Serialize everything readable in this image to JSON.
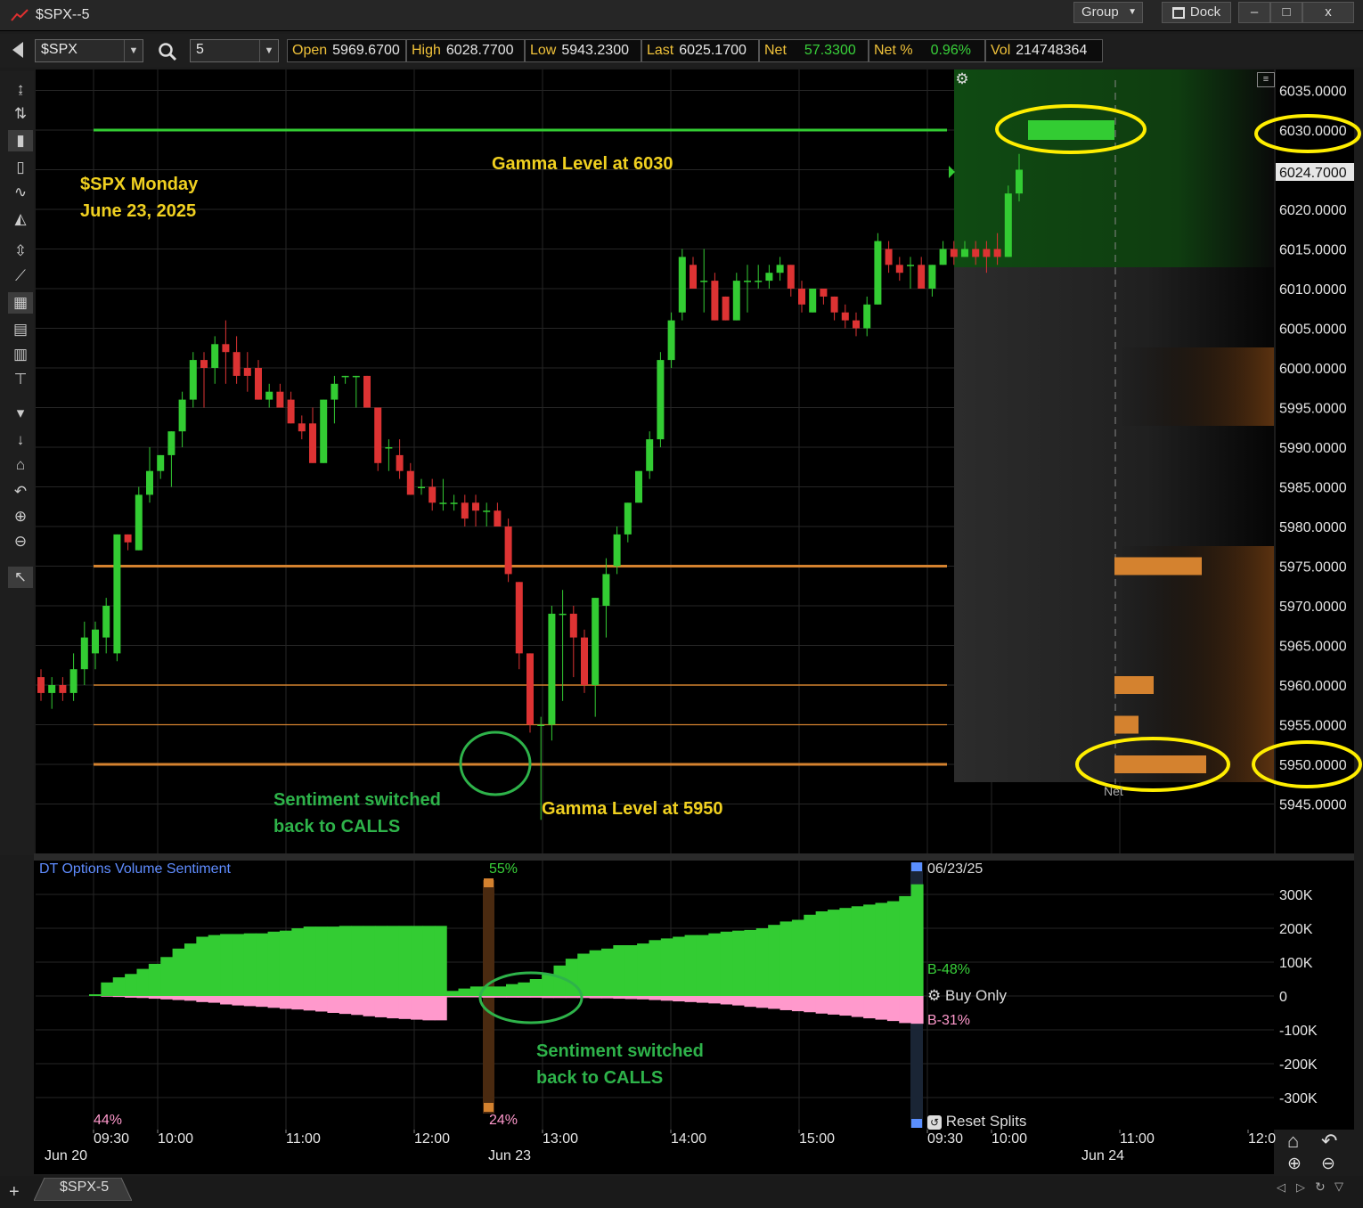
{
  "window": {
    "title": "$SPX--5",
    "group_label": "Group",
    "dock_label": "Dock",
    "min_label": "–",
    "max_label": "□",
    "close_label": "x"
  },
  "toolbar": {
    "symbol": "$SPX",
    "interval": "5",
    "quotes": [
      {
        "label": "Open",
        "value": "5969.6700",
        "tone": "white"
      },
      {
        "label": "High",
        "value": "6028.7700",
        "tone": "white"
      },
      {
        "label": "Low",
        "value": "5943.2300",
        "tone": "white"
      },
      {
        "label": "Last",
        "value": "6025.1700",
        "tone": "white"
      },
      {
        "label": "Net",
        "value": "57.3300",
        "tone": "green"
      },
      {
        "label": "Net %",
        "value": "0.96%",
        "tone": "green"
      },
      {
        "label": "Vol",
        "value": "214748364",
        "tone": "white"
      }
    ]
  },
  "left_tools": [
    "arrows-vertical-icon",
    "cursor-split-icon",
    "candles-icon",
    "bars-icon",
    "line-icon",
    "mountain-icon",
    "scale-icon",
    "trendline-icon",
    "grid-icon",
    "table-icon",
    "table-small-icon",
    "crosshair-icon",
    "draw-down-icon",
    "small-arrow-icon",
    "home-icon",
    "undo-icon",
    "zoom-in-icon",
    "zoom-out-icon",
    "pointer-icon"
  ],
  "price_axis": {
    "ticks": [
      "6035.0000",
      "6030.0000",
      "6025.0000",
      "6020.0000",
      "6015.0000",
      "6010.0000",
      "6005.0000",
      "6000.0000",
      "5995.0000",
      "5990.0000",
      "5985.0000",
      "5980.0000",
      "5975.0000",
      "5970.0000",
      "5965.0000",
      "5960.0000",
      "5955.0000",
      "5950.0000",
      "5945.0000"
    ],
    "last_price": "6024.7000"
  },
  "annotations": {
    "title_line1": "$SPX Monday",
    "title_line2": "June 23, 2025",
    "gamma_top": "Gamma Level at 6030",
    "gamma_bottom": "Gamma Level at 5950",
    "sentiment_line1": "Sentiment switched",
    "sentiment_line2": "back to CALLS",
    "sentiment2_line1": "Sentiment switched",
    "sentiment2_line2": "back to CALLS"
  },
  "gamma_panel": {
    "net_label": "Net"
  },
  "chart_data": [
    {
      "type": "candlestick",
      "title": "$SPX",
      "ylim": [
        5942,
        6038
      ],
      "horizontal_levels": [
        6030,
        5975,
        5960,
        5955,
        5950
      ],
      "candles": [
        {
          "o": 5961,
          "h": 5962,
          "l": 5958,
          "c": 5959
        },
        {
          "o": 5959,
          "h": 5961,
          "l": 5957,
          "c": 5960
        },
        {
          "o": 5960,
          "h": 5961,
          "l": 5958,
          "c": 5959
        },
        {
          "o": 5959,
          "h": 5964,
          "l": 5958,
          "c": 5962
        },
        {
          "o": 5962,
          "h": 5968,
          "l": 5960,
          "c": 5966
        },
        {
          "o": 5964,
          "h": 5968,
          "l": 5962,
          "c": 5967
        },
        {
          "o": 5966,
          "h": 5971,
          "l": 5964,
          "c": 5970
        },
        {
          "o": 5964,
          "h": 5979,
          "l": 5963,
          "c": 5979
        },
        {
          "o": 5979,
          "h": 5979,
          "l": 5977,
          "c": 5978
        },
        {
          "o": 5977,
          "h": 5985,
          "l": 5977,
          "c": 5984
        },
        {
          "o": 5984,
          "h": 5990,
          "l": 5983,
          "c": 5987
        },
        {
          "o": 5987,
          "h": 5989,
          "l": 5986,
          "c": 5989
        },
        {
          "o": 5989,
          "h": 5992,
          "l": 5985,
          "c": 5992
        },
        {
          "o": 5992,
          "h": 5997,
          "l": 5990,
          "c": 5996
        },
        {
          "o": 5996,
          "h": 6002,
          "l": 5995,
          "c": 6001
        },
        {
          "o": 6001,
          "h": 6002,
          "l": 5995,
          "c": 6000
        },
        {
          "o": 6000,
          "h": 6004,
          "l": 5998,
          "c": 6003
        },
        {
          "o": 6003,
          "h": 6006,
          "l": 5998,
          "c": 6002
        },
        {
          "o": 6002,
          "h": 6004,
          "l": 5998,
          "c": 5999
        },
        {
          "o": 6000,
          "h": 6002,
          "l": 5997,
          "c": 5999
        },
        {
          "o": 6000,
          "h": 6001,
          "l": 5996,
          "c": 5996
        },
        {
          "o": 5996,
          "h": 5998,
          "l": 5995,
          "c": 5997
        },
        {
          "o": 5997,
          "h": 5998,
          "l": 5995,
          "c": 5995
        },
        {
          "o": 5996,
          "h": 5997,
          "l": 5993,
          "c": 5993
        },
        {
          "o": 5993,
          "h": 5994,
          "l": 5991,
          "c": 5992
        },
        {
          "o": 5993,
          "h": 5995,
          "l": 5988,
          "c": 5988
        },
        {
          "o": 5988,
          "h": 5996,
          "l": 5988,
          "c": 5996
        },
        {
          "o": 5996,
          "h": 5999,
          "l": 5993,
          "c": 5998
        },
        {
          "o": 5999,
          "h": 5999,
          "l": 5998,
          "c": 5999
        },
        {
          "o": 5999,
          "h": 5999,
          "l": 5995,
          "c": 5999
        },
        {
          "o": 5999,
          "h": 5999,
          "l": 5995,
          "c": 5995
        },
        {
          "o": 5995,
          "h": 5995,
          "l": 5987,
          "c": 5988
        },
        {
          "o": 5990,
          "h": 5991,
          "l": 5987,
          "c": 5990
        },
        {
          "o": 5989,
          "h": 5991,
          "l": 5986,
          "c": 5987
        },
        {
          "o": 5987,
          "h": 5988,
          "l": 5984,
          "c": 5984
        },
        {
          "o": 5985,
          "h": 5986,
          "l": 5984,
          "c": 5985
        },
        {
          "o": 5985,
          "h": 5986,
          "l": 5982,
          "c": 5983
        },
        {
          "o": 5983,
          "h": 5986,
          "l": 5982,
          "c": 5983
        },
        {
          "o": 5983,
          "h": 5984,
          "l": 5982,
          "c": 5983
        },
        {
          "o": 5983,
          "h": 5984,
          "l": 5980,
          "c": 5981
        },
        {
          "o": 5983,
          "h": 5984,
          "l": 5980,
          "c": 5982
        },
        {
          "o": 5982,
          "h": 5983,
          "l": 5980,
          "c": 5982
        },
        {
          "o": 5982,
          "h": 5983,
          "l": 5980,
          "c": 5980
        },
        {
          "o": 5980,
          "h": 5981,
          "l": 5973,
          "c": 5974
        },
        {
          "o": 5973,
          "h": 5973,
          "l": 5962,
          "c": 5964
        },
        {
          "o": 5964,
          "h": 5964,
          "l": 5954,
          "c": 5955
        },
        {
          "o": 5955,
          "h": 5956,
          "l": 5943,
          "c": 5955
        },
        {
          "o": 5955,
          "h": 5970,
          "l": 5953,
          "c": 5969
        },
        {
          "o": 5969,
          "h": 5972,
          "l": 5958,
          "c": 5969
        },
        {
          "o": 5969,
          "h": 5970,
          "l": 5961,
          "c": 5966
        },
        {
          "o": 5966,
          "h": 5967,
          "l": 5959,
          "c": 5960
        },
        {
          "o": 5960,
          "h": 5971,
          "l": 5956,
          "c": 5971
        },
        {
          "o": 5970,
          "h": 5976,
          "l": 5966,
          "c": 5974
        },
        {
          "o": 5975,
          "h": 5980,
          "l": 5974,
          "c": 5979
        },
        {
          "o": 5979,
          "h": 5983,
          "l": 5978,
          "c": 5983
        },
        {
          "o": 5983,
          "h": 5987,
          "l": 5983,
          "c": 5987
        },
        {
          "o": 5987,
          "h": 5992,
          "l": 5986,
          "c": 5991
        },
        {
          "o": 5991,
          "h": 6002,
          "l": 5990,
          "c": 6001
        },
        {
          "o": 6001,
          "h": 6007,
          "l": 6000,
          "c": 6006
        },
        {
          "o": 6007,
          "h": 6015,
          "l": 6006,
          "c": 6014
        },
        {
          "o": 6013,
          "h": 6014,
          "l": 6010,
          "c": 6010
        },
        {
          "o": 6011,
          "h": 6015,
          "l": 6007,
          "c": 6011
        },
        {
          "o": 6011,
          "h": 6012,
          "l": 6006,
          "c": 6006
        },
        {
          "o": 6009,
          "h": 6009,
          "l": 6006,
          "c": 6006
        },
        {
          "o": 6006,
          "h": 6012,
          "l": 6006,
          "c": 6011
        },
        {
          "o": 6011,
          "h": 6013,
          "l": 6007,
          "c": 6011
        },
        {
          "o": 6011,
          "h": 6013,
          "l": 6010,
          "c": 6011
        },
        {
          "o": 6011,
          "h": 6013,
          "l": 6010,
          "c": 6012
        },
        {
          "o": 6012,
          "h": 6014,
          "l": 6011,
          "c": 6013
        },
        {
          "o": 6013,
          "h": 6013,
          "l": 6009,
          "c": 6010
        },
        {
          "o": 6010,
          "h": 6011,
          "l": 6007,
          "c": 6008
        },
        {
          "o": 6007,
          "h": 6010,
          "l": 6007,
          "c": 6010
        },
        {
          "o": 6010,
          "h": 6010,
          "l": 6008,
          "c": 6009
        },
        {
          "o": 6009,
          "h": 6009,
          "l": 6006,
          "c": 6007
        },
        {
          "o": 6007,
          "h": 6008,
          "l": 6005,
          "c": 6006
        },
        {
          "o": 6006,
          "h": 6007,
          "l": 6004,
          "c": 6005
        },
        {
          "o": 6005,
          "h": 6009,
          "l": 6004,
          "c": 6008
        },
        {
          "o": 6008,
          "h": 6017,
          "l": 6008,
          "c": 6016
        },
        {
          "o": 6015,
          "h": 6016,
          "l": 6012,
          "c": 6013
        },
        {
          "o": 6013,
          "h": 6014,
          "l": 6011,
          "c": 6012
        },
        {
          "o": 6013,
          "h": 6014,
          "l": 6010,
          "c": 6013
        },
        {
          "o": 6013,
          "h": 6014,
          "l": 6010,
          "c": 6010
        },
        {
          "o": 6010,
          "h": 6013,
          "l": 6009,
          "c": 6013
        },
        {
          "o": 6013,
          "h": 6016,
          "l": 6013,
          "c": 6015
        },
        {
          "o": 6015,
          "h": 6016,
          "l": 6013,
          "c": 6014
        },
        {
          "o": 6014,
          "h": 6016,
          "l": 6014,
          "c": 6015
        },
        {
          "o": 6015,
          "h": 6016,
          "l": 6013,
          "c": 6014
        },
        {
          "o": 6015,
          "h": 6016,
          "l": 6012,
          "c": 6014
        },
        {
          "o": 6015,
          "h": 6017,
          "l": 6013,
          "c": 6014
        },
        {
          "o": 6014,
          "h": 6023,
          "l": 6014,
          "c": 6022
        },
        {
          "o": 6022,
          "h": 6027,
          "l": 6021,
          "c": 6025
        }
      ]
    },
    {
      "type": "area",
      "title": "DT Options Volume Sentiment",
      "ylim": [
        -380000,
        380000
      ],
      "y_ticks": [
        "300K",
        "200K",
        "100K",
        "0",
        "-100K",
        "-200K",
        "-300K"
      ],
      "series": [
        {
          "name": "B-48%",
          "values": [
            5000,
            40000,
            55000,
            65000,
            80000,
            95000,
            115000,
            140000,
            155000,
            175000,
            180000,
            183000,
            183000,
            185000,
            185000,
            190000,
            193000,
            200000,
            205000,
            205000,
            205000,
            207000,
            207000,
            207000,
            207000,
            207000,
            207000,
            207000,
            207000,
            207000,
            15000,
            22000,
            28000,
            28000,
            28000,
            35000,
            40000,
            50000,
            65000,
            90000,
            110000,
            125000,
            135000,
            140000,
            150000,
            150000,
            155000,
            165000,
            170000,
            175000,
            180000,
            180000,
            185000,
            190000,
            193000,
            195000,
            200000,
            210000,
            220000,
            225000,
            240000,
            250000,
            255000,
            260000,
            265000,
            270000,
            275000,
            280000,
            295000,
            330000
          ]
        },
        {
          "name": "B-31%",
          "values": [
            0,
            -2000,
            -3000,
            -5000,
            -6000,
            -8000,
            -10000,
            -12000,
            -14000,
            -18000,
            -20000,
            -25000,
            -28000,
            -30000,
            -32000,
            -35000,
            -38000,
            -40000,
            -43000,
            -46000,
            -50000,
            -53000,
            -56000,
            -60000,
            -63000,
            -66000,
            -68000,
            -70000,
            -72000,
            -72000,
            -4000,
            -4000,
            -4000,
            -5000,
            -5000,
            -5000,
            -5000,
            -5000,
            -6000,
            -6000,
            -6000,
            -6000,
            -7000,
            -7000,
            -8000,
            -9000,
            -10000,
            -12000,
            -14000,
            -16000,
            -18000,
            -20000,
            -22000,
            -25000,
            -28000,
            -32000,
            -35000,
            -38000,
            -42000,
            -45000,
            -48000,
            -52000,
            -55000,
            -58000,
            -62000,
            -66000,
            -70000,
            -74000,
            -80000,
            -82000
          ]
        }
      ]
    }
  ],
  "sentiment_panel": {
    "title": "DT Options Volume Sentiment",
    "pct_top": "55%",
    "pct_bottom": "24%",
    "pct_left": "44%",
    "date": "06/23/25",
    "buy_label": "B-48%",
    "sell_label": "B-31%",
    "buy_only": "Buy Only",
    "reset_splits": "Reset Splits",
    "color_buy": "#33cc33",
    "color_sell": "#ff99cc"
  },
  "time_axis": {
    "ticks": [
      "09:30",
      "10:00",
      "11:00",
      "12:00",
      "13:00",
      "14:00",
      "15:00",
      "09:30",
      "10:00",
      "11:00",
      "12:0"
    ],
    "dates": [
      "Jun 20",
      "Jun 23",
      "Jun 24"
    ]
  },
  "status_bar": {
    "tab_label": "$SPX-5"
  }
}
